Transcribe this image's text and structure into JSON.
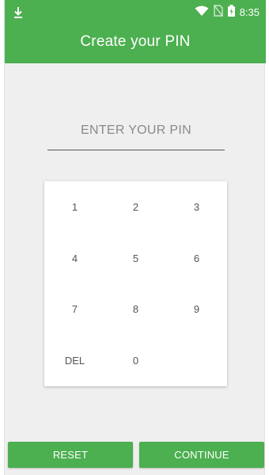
{
  "status_bar": {
    "time": "8:35",
    "icons": [
      "download-icon",
      "wifi-icon",
      "no-sim-icon",
      "battery-charging-icon"
    ]
  },
  "header": {
    "title": "Create your PIN",
    "color": "#4caf50"
  },
  "pin_field": {
    "placeholder": "ENTER YOUR PIN",
    "value": ""
  },
  "keypad": {
    "keys": [
      {
        "label": "1",
        "name": "key-1"
      },
      {
        "label": "2",
        "name": "key-2"
      },
      {
        "label": "3",
        "name": "key-3"
      },
      {
        "label": "4",
        "name": "key-4"
      },
      {
        "label": "5",
        "name": "key-5"
      },
      {
        "label": "6",
        "name": "key-6"
      },
      {
        "label": "7",
        "name": "key-7"
      },
      {
        "label": "8",
        "name": "key-8"
      },
      {
        "label": "9",
        "name": "key-9"
      },
      {
        "label": "DEL",
        "name": "key-delete"
      },
      {
        "label": "0",
        "name": "key-0"
      },
      {
        "label": "",
        "name": "key-empty"
      }
    ]
  },
  "actions": {
    "reset_label": "RESET",
    "continue_label": "CONTINUE"
  }
}
